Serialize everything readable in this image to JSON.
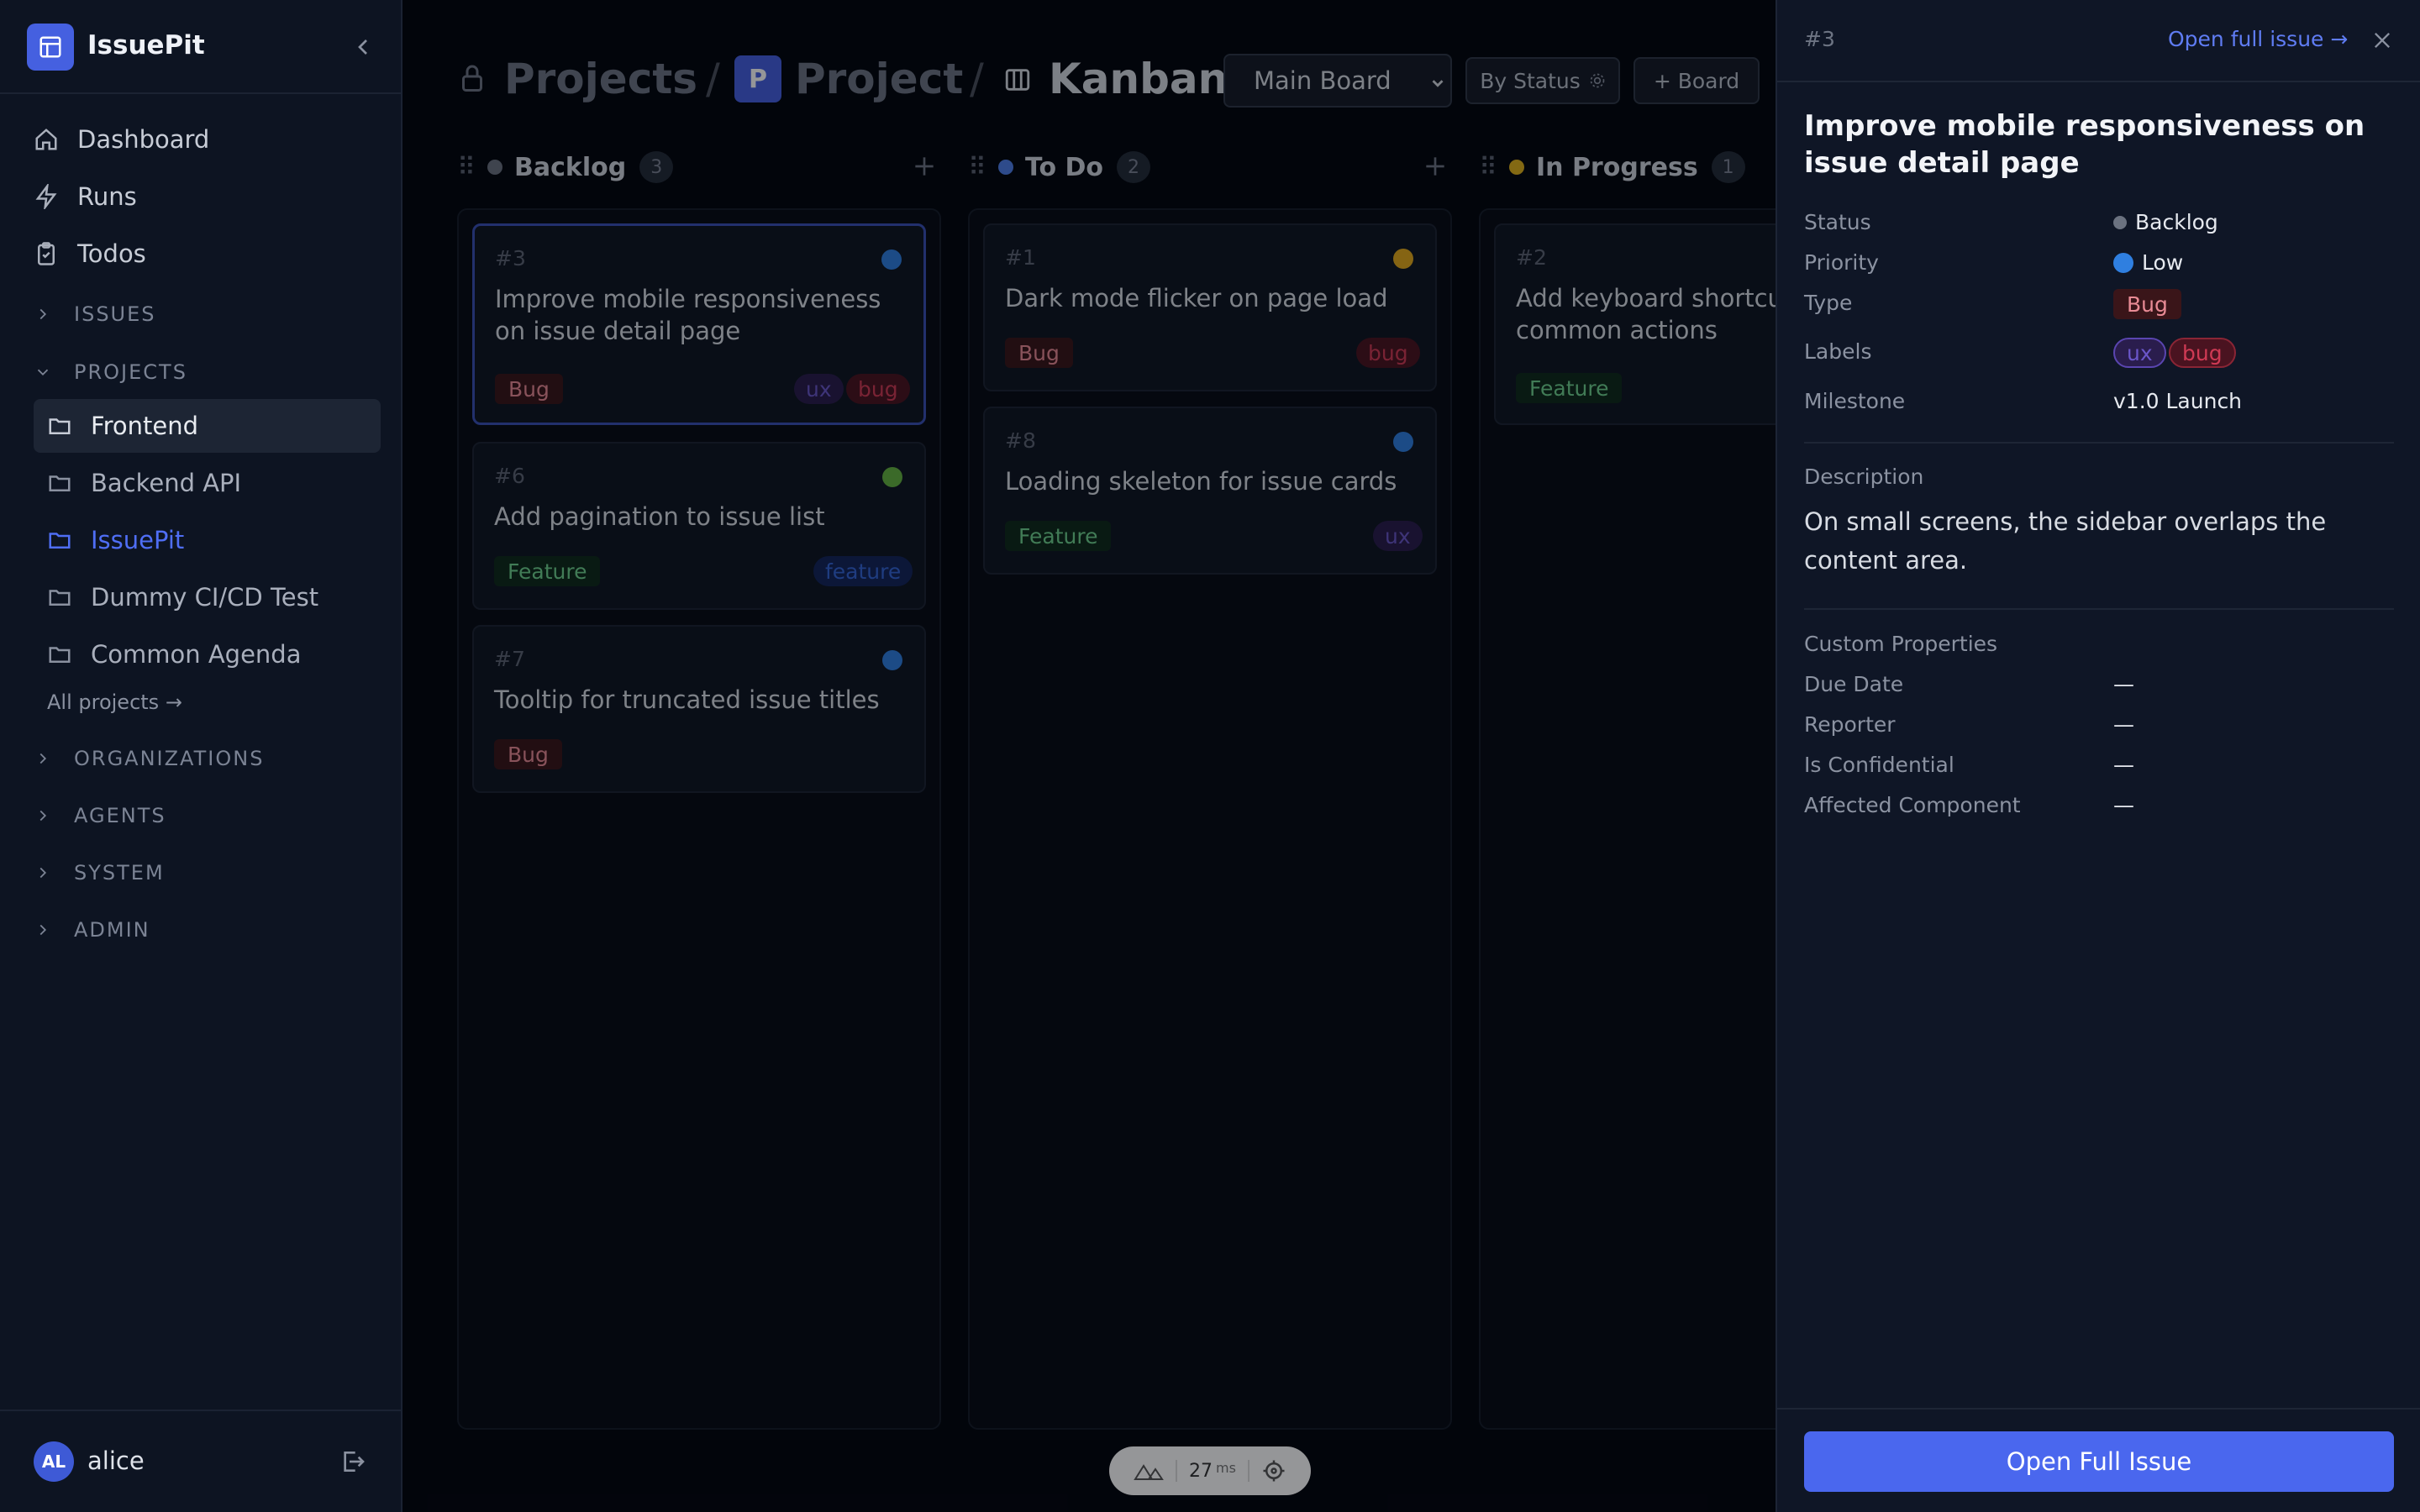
{
  "sidebar": {
    "app_name": "IssuePit",
    "nav": [
      {
        "label": "Dashboard",
        "icon": "home-icon"
      },
      {
        "label": "Runs",
        "icon": "bolt-icon"
      },
      {
        "label": "Todos",
        "icon": "clipboard-icon"
      }
    ],
    "sections": {
      "issues": "ISSUES",
      "projects": "PROJECTS",
      "organizations": "ORGANIZATIONS",
      "agents": "AGENTS",
      "system": "SYSTEM",
      "admin": "ADMIN"
    },
    "projects": [
      "Frontend",
      "Backend API",
      "IssuePit",
      "Dummy CI/CD Test",
      "Common Agenda"
    ],
    "selected_project": "Frontend",
    "active_project": "IssuePit",
    "all_projects": "All projects →",
    "user": {
      "initials": "AL",
      "name": "alice"
    }
  },
  "header": {
    "crumb_projects": "Projects",
    "sep": "/",
    "project_badge": "P",
    "crumb_project": "Project",
    "crumb_view": "Kanban",
    "board_select": "Main Board",
    "group_button": "By Status",
    "add_board": "+ Board"
  },
  "columns": [
    {
      "title": "Backlog",
      "count": "3",
      "color": "#6b7280",
      "cards": [
        {
          "num": "#3",
          "title": "Improve mobile responsiveness on issue detail page",
          "priority_color": "#2f7fe0",
          "type": "Bug",
          "labels": [
            "ux",
            "bug"
          ]
        },
        {
          "num": "#6",
          "title": "Add pagination to issue list",
          "priority_color": "#64b340",
          "type": "Feature",
          "labels": [
            "feature"
          ]
        },
        {
          "num": "#7",
          "title": "Tooltip for truncated issue titles",
          "priority_color": "#2f7fe0",
          "type": "Bug",
          "labels": []
        }
      ]
    },
    {
      "title": "To Do",
      "count": "2",
      "color": "#4f7fe8",
      "cards": [
        {
          "num": "#1",
          "title": "Dark mode flicker on page load",
          "priority_color": "#e3a91a",
          "type": "Bug",
          "labels": [
            "bug"
          ]
        },
        {
          "num": "#8",
          "title": "Loading skeleton for issue cards",
          "priority_color": "#2f7fe0",
          "type": "Feature",
          "labels": [
            "ux"
          ]
        }
      ]
    },
    {
      "title": "In Progress",
      "count": "1",
      "color": "#e0b21a",
      "cards": [
        {
          "num": "#2",
          "title": "Add keyboard shortcuts for common actions",
          "priority_color": "#e3a91a",
          "type": "Feature",
          "labels": []
        }
      ]
    }
  ],
  "panel": {
    "issue_num": "#3",
    "open_link": "Open full issue →",
    "title": "Improve mobile responsiveness on issue detail page",
    "fields": {
      "status_label": "Status",
      "status_value": "Backlog",
      "priority_label": "Priority",
      "priority_value": "Low",
      "type_label": "Type",
      "type_value": "Bug",
      "labels_label": "Labels",
      "labels": [
        "ux",
        "bug"
      ],
      "milestone_label": "Milestone",
      "milestone_value": "v1.0 Launch"
    },
    "description_label": "Description",
    "description": "On small screens, the sidebar overlaps the content area.",
    "custom_label": "Custom Properties",
    "custom": [
      {
        "name": "Due Date",
        "value": "—"
      },
      {
        "name": "Reporter",
        "value": "—"
      },
      {
        "name": "Is Confidential",
        "value": "—"
      },
      {
        "name": "Affected Component",
        "value": "—"
      }
    ],
    "open_button": "Open Full Issue"
  },
  "perf": {
    "value": "27",
    "unit": "ms"
  }
}
